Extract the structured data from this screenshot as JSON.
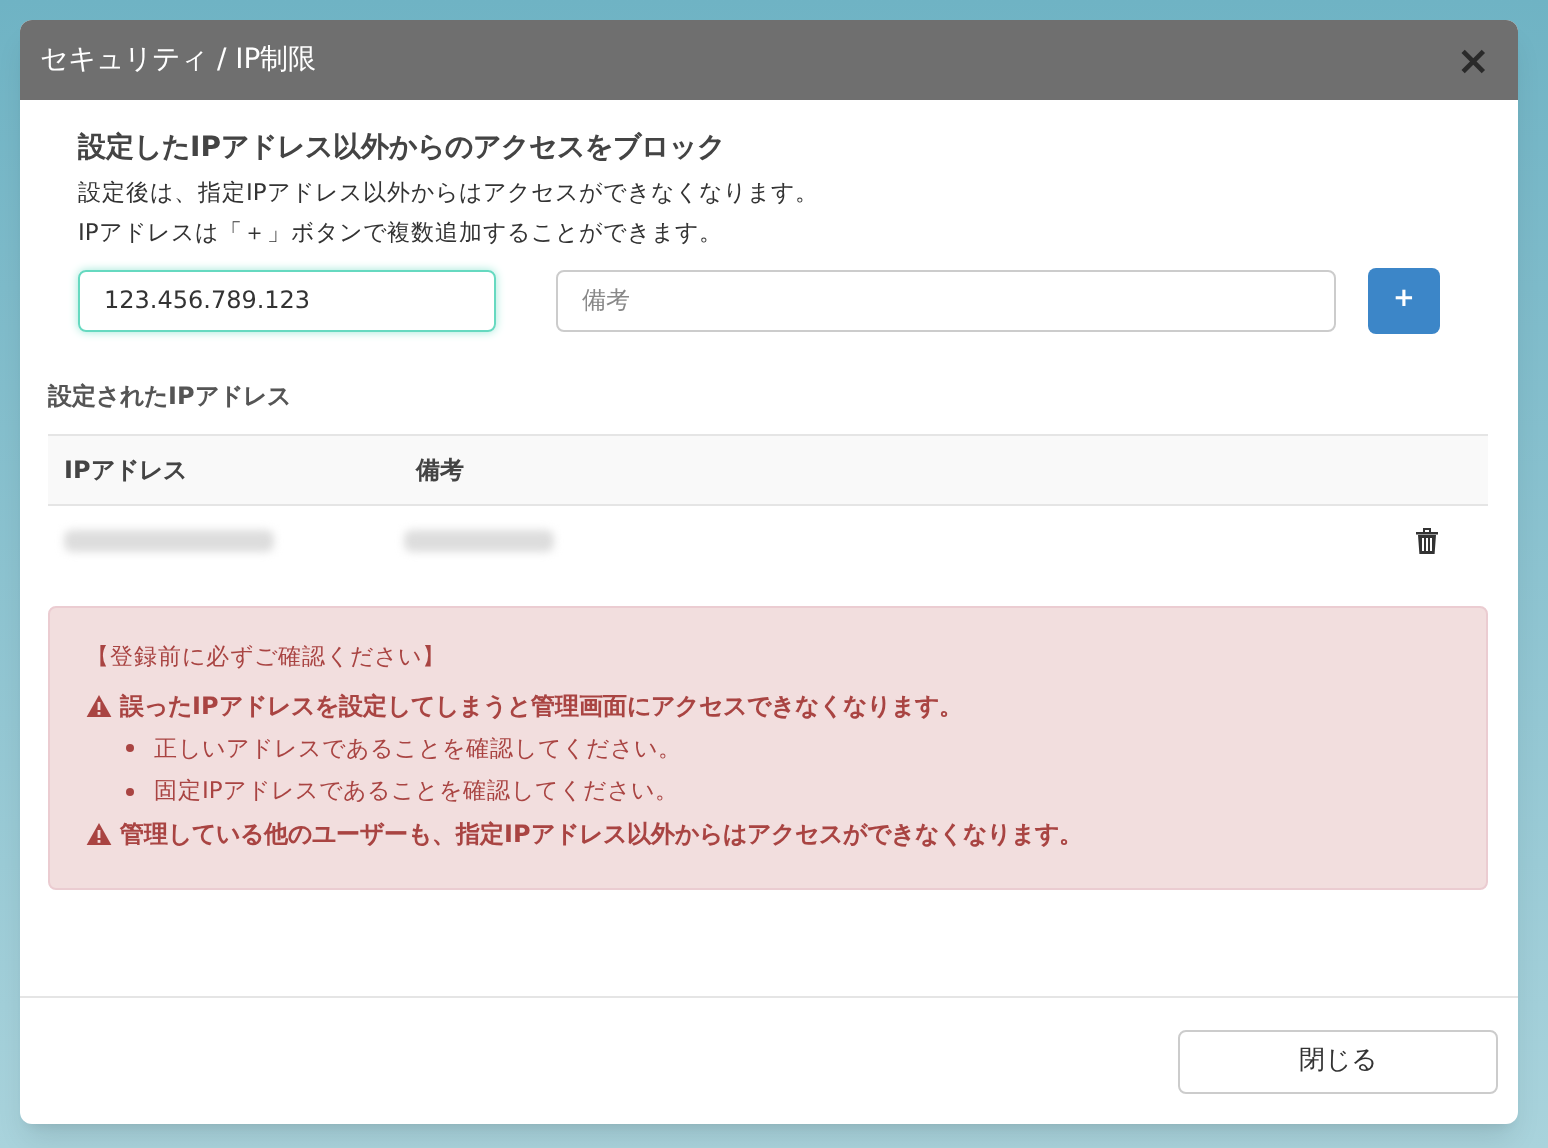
{
  "dialog": {
    "title": "セキュリティ / IP制限",
    "close": "×"
  },
  "intro": {
    "heading": "設定したIPアドレス以外からのアクセスをブロック",
    "lines": [
      "設定後は、指定IPアドレス以外からはアクセスができなくなります。",
      "IPアドレスは「＋」ボタンで複数追加することができます。"
    ]
  },
  "form": {
    "ip_value": "123.456.789.123",
    "note_placeholder": "備考",
    "add_button": "+"
  },
  "list": {
    "title": "設定されたIPアドレス",
    "columns": [
      "IPアドレス",
      "備考"
    ],
    "rows": [
      {
        "redacted": true
      }
    ]
  },
  "alert": {
    "title": "【登録前に必ずご確認ください】",
    "items": [
      {
        "kind": "warning",
        "text": "誤ったIPアドレスを設定してしまうと管理画面にアクセスできなくなります。"
      },
      {
        "kind": "bullet",
        "text": "正しいアドレスであることを確認してください。"
      },
      {
        "kind": "bullet",
        "text": "固定IPアドレスであることを確認してください。"
      },
      {
        "kind": "warning",
        "text": "管理している他のユーザーも、指定IPアドレス以外からはアクセスができなくなります。"
      }
    ]
  },
  "footer": {
    "close_button": "閉じる"
  }
}
